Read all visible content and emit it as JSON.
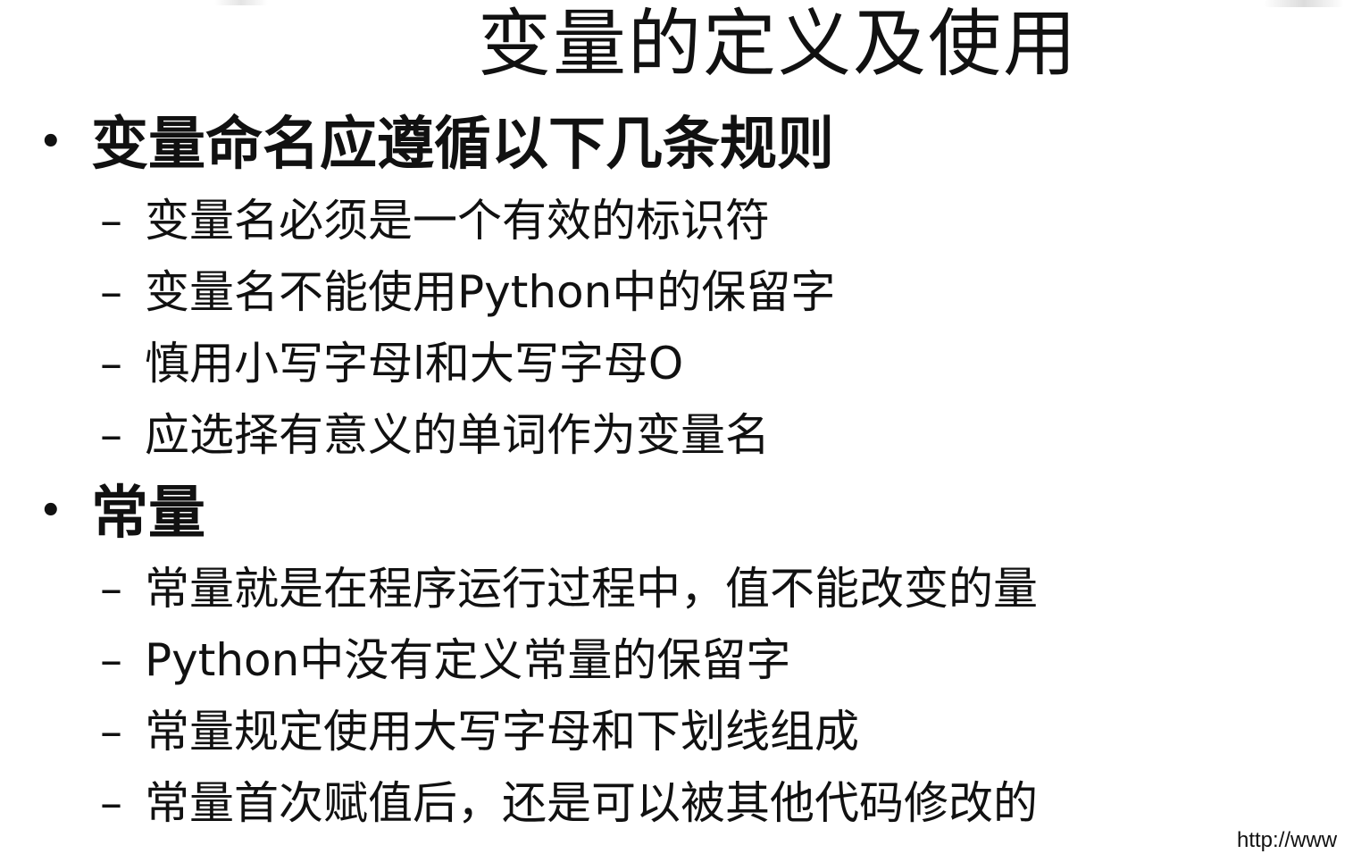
{
  "slide": {
    "title": "变量的定义及使用",
    "bullets": [
      {
        "marker": "•",
        "text": "变量命名应遵循以下几条规则",
        "items": [
          {
            "marker": "–",
            "text": "变量名必须是一个有效的标识符"
          },
          {
            "marker": "–",
            "text": "变量名不能使用Python中的保留字"
          },
          {
            "marker": "–",
            "text": "慎用小写字母l和大写字母O"
          },
          {
            "marker": "–",
            "text": "应选择有意义的单词作为变量名"
          }
        ]
      },
      {
        "marker": "•",
        "text": "常量",
        "items": [
          {
            "marker": "–",
            "text": "常量就是在程序运行过程中，值不能改变的量"
          },
          {
            "marker": "–",
            "text": "Python中没有定义常量的保留字"
          },
          {
            "marker": "–",
            "text": "常量规定使用大写字母和下划线组成"
          },
          {
            "marker": "–",
            "text": "常量首次赋值后，还是可以被其他代码修改的"
          }
        ]
      }
    ],
    "corner_url": "http://www"
  }
}
